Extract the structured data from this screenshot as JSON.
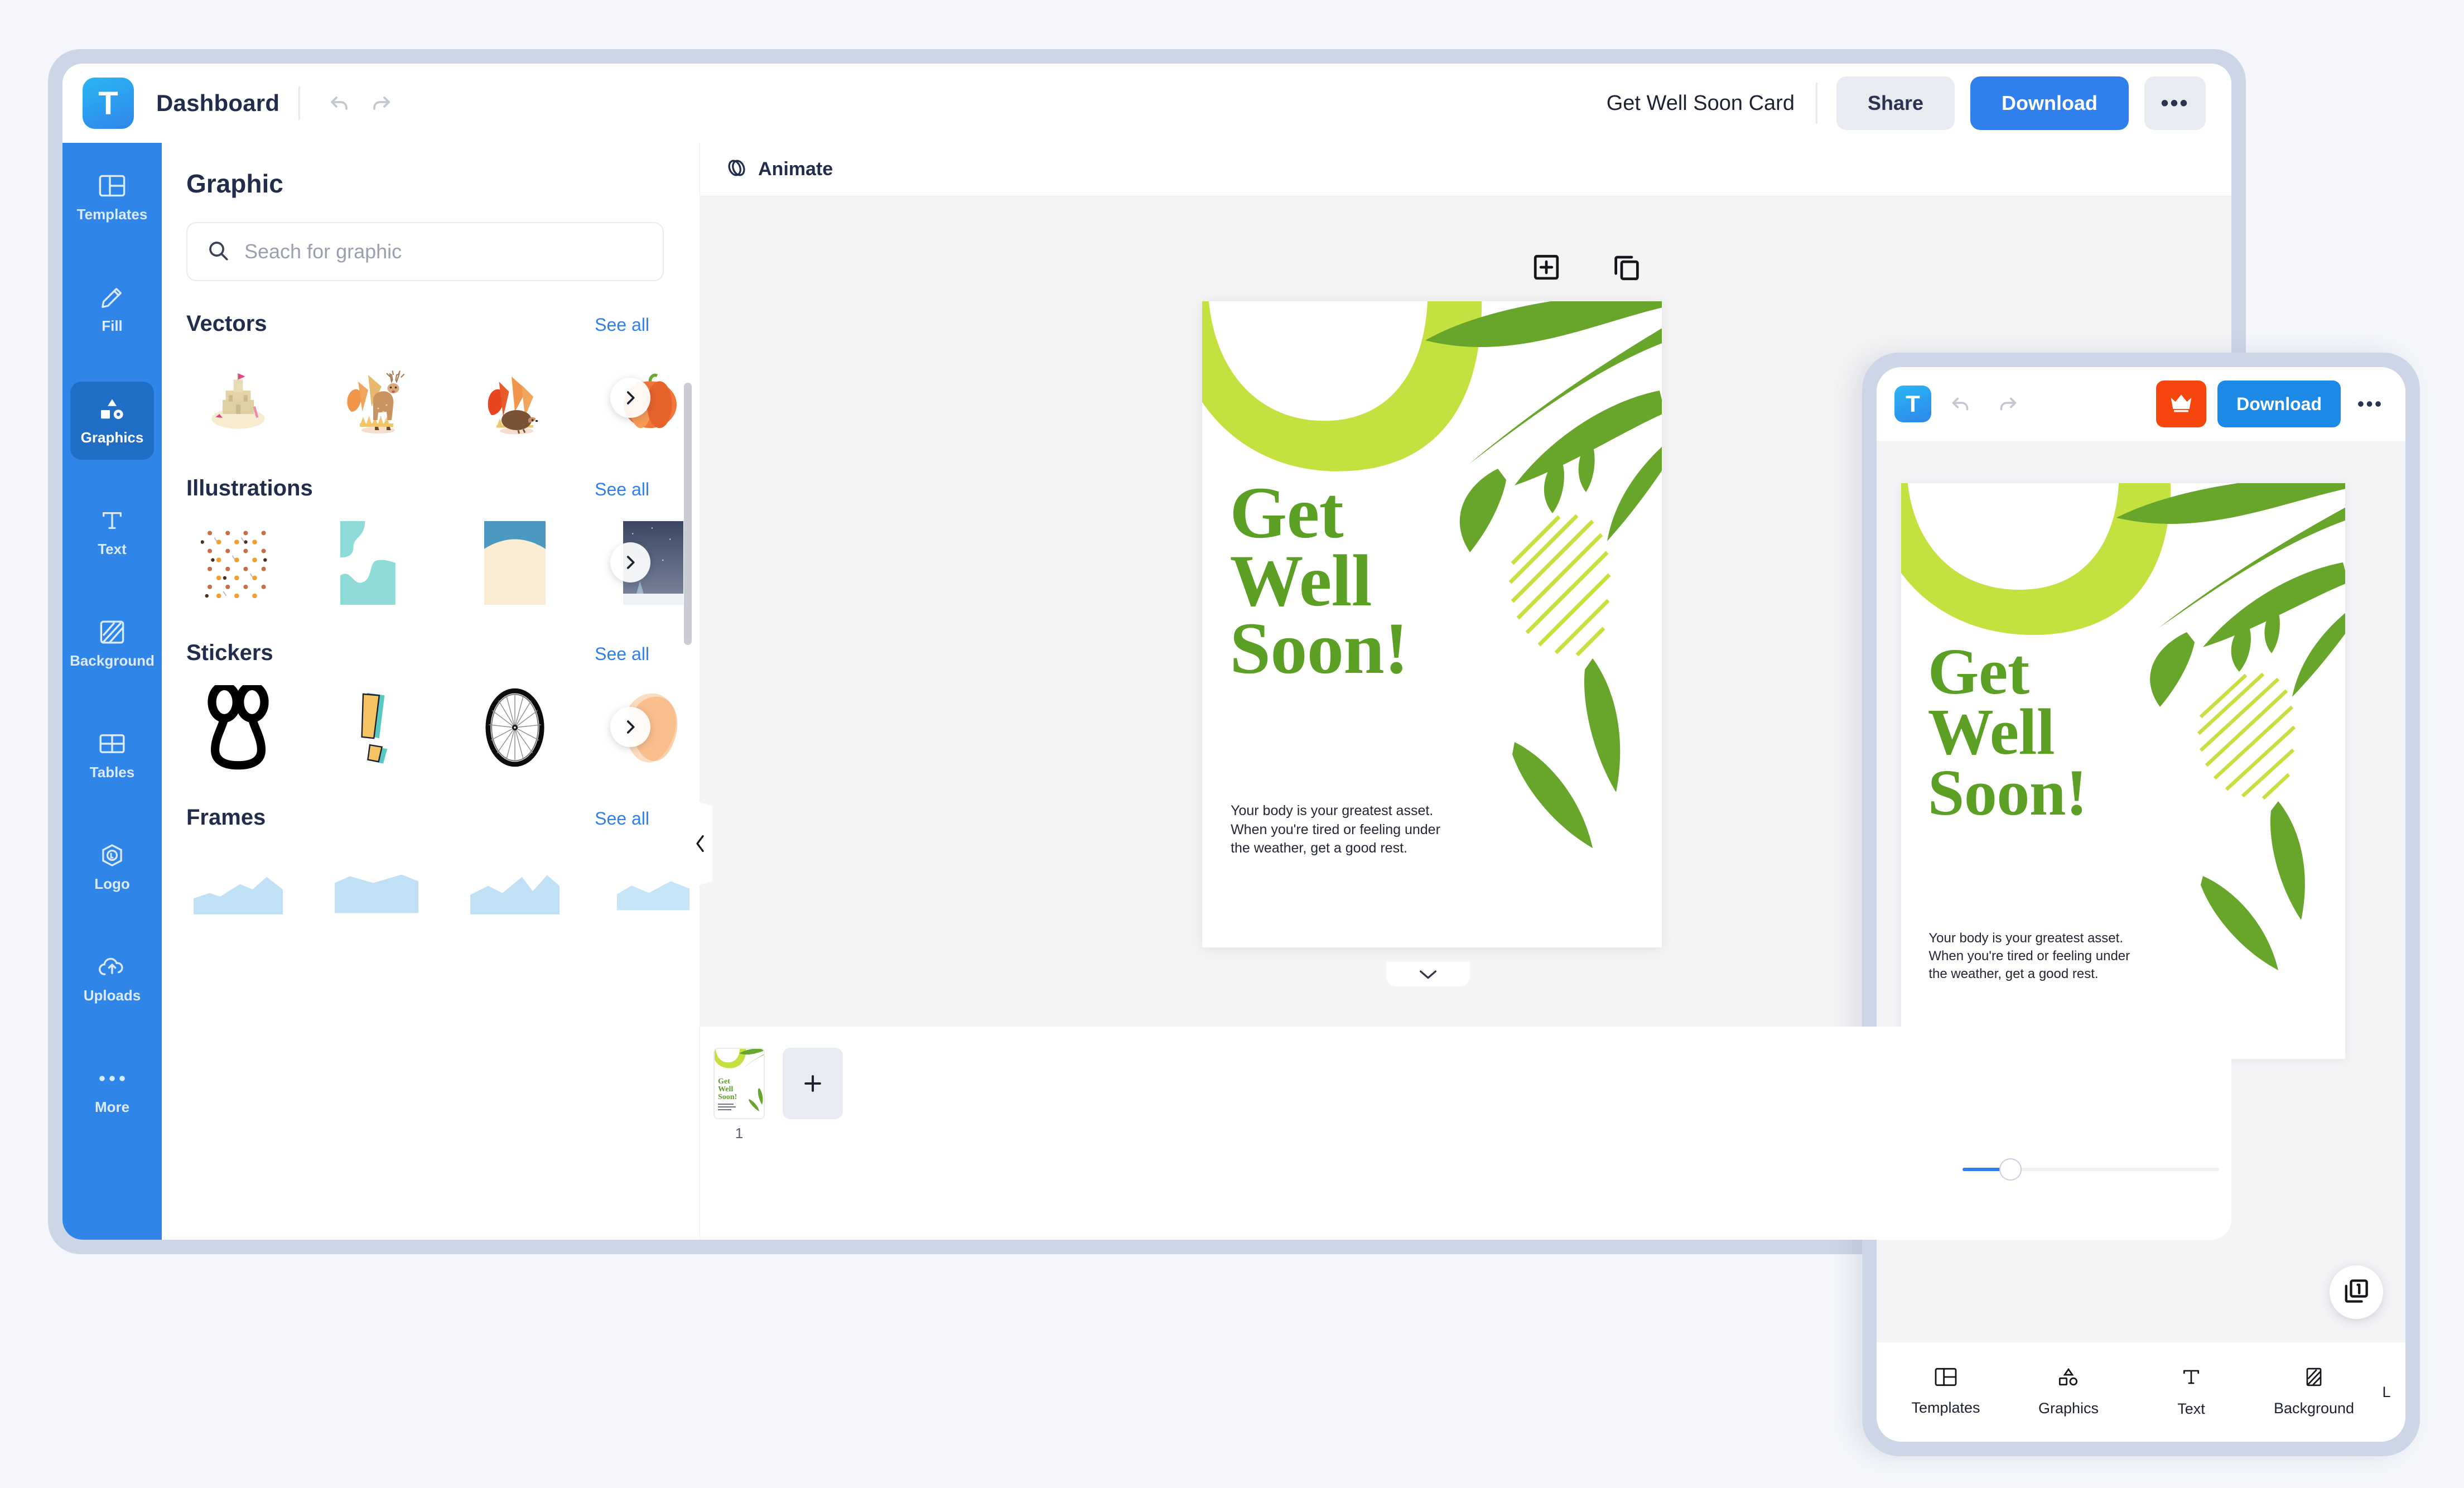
{
  "brand": {
    "logo_letter": "T",
    "accent_blue": "#2f7fed",
    "rail_blue": "#2f86e8",
    "rail_active_blue": "#1f6dc4",
    "crown_orange": "#f6460d",
    "card_green": "#5ba024",
    "card_lime": "#c3e13f"
  },
  "desktop": {
    "header": {
      "dashboard_label": "Dashboard",
      "undo_icon": "undo-icon",
      "redo_icon": "redo-icon",
      "document_title": "Get Well Soon Card",
      "share_label": "Share",
      "download_label": "Download",
      "more_label": "•••"
    },
    "rail": [
      {
        "label": "Templates",
        "icon": "templates-icon",
        "active": false
      },
      {
        "label": "Fill",
        "icon": "pencil-icon",
        "active": false
      },
      {
        "label": "Graphics",
        "icon": "shapes-icon",
        "active": true
      },
      {
        "label": "Text",
        "icon": "text-t-icon",
        "active": false
      },
      {
        "label": "Background",
        "icon": "hatched-square-icon",
        "active": false
      },
      {
        "label": "Tables",
        "icon": "table-grid-icon",
        "active": false
      },
      {
        "label": "Logo",
        "icon": "hexagon-l-icon",
        "active": false
      },
      {
        "label": "Uploads",
        "icon": "cloud-upload-icon",
        "active": false
      },
      {
        "label": "More",
        "icon": "ellipsis-icon",
        "active": false
      }
    ],
    "panel": {
      "title": "Graphic",
      "search_placeholder": "Seach for graphic",
      "search_value": "",
      "search_icon": "search-icon",
      "collapse_icon": "chevron-left-icon",
      "sections": [
        {
          "title": "Vectors",
          "see_all": "See all",
          "kind": "vectors"
        },
        {
          "title": "Illustrations",
          "see_all": "See all",
          "kind": "illustrations"
        },
        {
          "title": "Stickers",
          "see_all": "See all",
          "kind": "stickers"
        },
        {
          "title": "Frames",
          "see_all": "See all",
          "kind": "frames"
        }
      ]
    },
    "toolbar": {
      "animate_label": "Animate",
      "animate_icon": "animate-shapes-icon",
      "add_page_icon": "add-square-icon",
      "duplicate_icon": "duplicate-icon",
      "collapse_canvas_icon": "chevron-down-icon"
    },
    "pages": {
      "page_number": "1",
      "add_page_label": "+"
    },
    "zoom": {
      "value": 17
    }
  },
  "mobile": {
    "header": {
      "logo_letter": "T",
      "undo_icon": "undo-icon",
      "redo_icon": "redo-icon",
      "crown_icon": "crown-icon",
      "download_label": "Download",
      "more_label": "•••"
    },
    "layers_button": {
      "icon": "layers-1-icon",
      "count": "1"
    },
    "tabs": [
      {
        "label": "Templates",
        "icon": "templates-icon"
      },
      {
        "label": "Graphics",
        "icon": "shapes-icon"
      },
      {
        "label": "Text",
        "icon": "text-t-icon"
      },
      {
        "label": "Background",
        "icon": "hatched-square-icon"
      },
      {
        "label": "L",
        "icon": "hexagon-l-icon"
      }
    ]
  },
  "card": {
    "headline_line1": "Get",
    "headline_line2": "Well",
    "headline_line3": "Soon!",
    "body_line1": "Your body is your greatest asset.",
    "body_line2": "When you're tired or feeling under",
    "body_line3": "the weather, get a good rest."
  }
}
